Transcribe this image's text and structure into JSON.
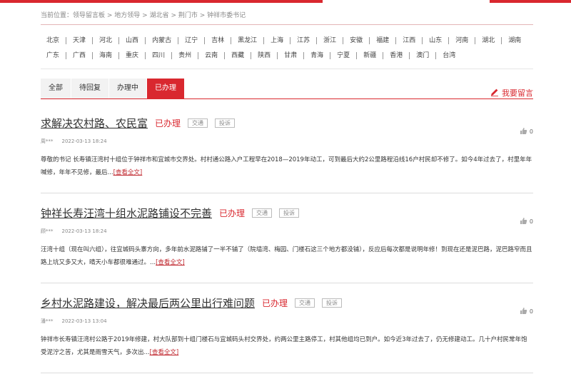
{
  "theme": {
    "accent": "#d9282f"
  },
  "breadcrumb": {
    "prefix": "当前位置：",
    "items": [
      "领导留言板",
      "地方领导",
      "湖北省",
      "荆门市",
      "钟祥市委书记"
    ],
    "separator": " > "
  },
  "regions": {
    "row1": [
      "北京",
      "天津",
      "河北",
      "山西",
      "内蒙古",
      "辽宁",
      "吉林",
      "黑龙江",
      "上海",
      "江苏",
      "浙江",
      "安徽",
      "福建",
      "江西",
      "山东",
      "河南",
      "湖北",
      "湖南"
    ],
    "row2": [
      "广东",
      "广西",
      "海南",
      "重庆",
      "四川",
      "贵州",
      "云南",
      "西藏",
      "陕西",
      "甘肃",
      "青海",
      "宁夏",
      "新疆",
      "香港",
      "澳门",
      "台湾"
    ]
  },
  "tabs": [
    {
      "label": "全部",
      "active": false
    },
    {
      "label": "待回复",
      "active": false
    },
    {
      "label": "办理中",
      "active": false
    },
    {
      "label": "已办理",
      "active": true
    }
  ],
  "leave_message": {
    "label": "我要留言",
    "icon": "pencil-icon"
  },
  "posts": [
    {
      "title": "求解决农村路、农民富",
      "status": "已办理",
      "tags": [
        "交通",
        "投诉"
      ],
      "author": "周***",
      "date": "2022-03-13 18:24",
      "body": "尊敬的书记 长寿镇汪湾村十组位于钟祥市和宜城市交界处。村村通公路入户工程早在2018—2019年动工，可到最后大约2公里路程沿线16户村民却不修了。如今4年过去了，村里年年喊修，年年不见修，最后...",
      "more": "[查看全文]",
      "likes": "0"
    },
    {
      "title": "钟祥长寿汪湾十组水泥路铺设不完善",
      "status": "已办理",
      "tags": [
        "交通",
        "投诉"
      ],
      "author": "顾***",
      "date": "2022-03-13 18:24",
      "body": "汪湾十组（现在叫六组），往宜城码头寨方向，多年前水泥路铺了一半不铺了（院墙湾、梅园、门楼石这三个地方都没铺），反应后每次都是说明年修！到现在还是泥巴路，泥巴路窄而且路上坑又多又大，晴天小车都很难通过。...",
      "more": "[查看全文]",
      "likes": "0"
    },
    {
      "title": "乡村水泥路建设，解决最后两公里出行难问题",
      "status": "已办理",
      "tags": [
        "交通",
        "投诉"
      ],
      "author": "潘***",
      "date": "2022-03-13 13:04",
      "body": "钟祥市长寿镇汪湾村公路于2019年修建，村大队部到十组门楼石与宜城码头村交界处，约两公里主路停工，村其他组均已到户。如今近3年过去了，仍无修建动工。几十户村民常年饱受泥泞之苦，尤其是雨雪天气，多次出...",
      "more": "[查看全文]",
      "likes": "0"
    }
  ]
}
